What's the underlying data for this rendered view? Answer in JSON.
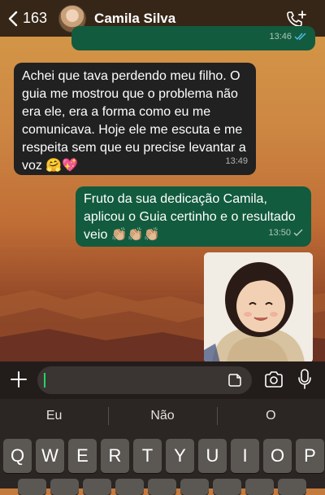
{
  "header": {
    "back_count": "163",
    "contact_name": "Camila Silva"
  },
  "messages": [
    {
      "direction": "out",
      "text": "",
      "time": "13:46",
      "status": "read"
    },
    {
      "direction": "in",
      "text": "Achei que tava  perdendo meu filho. O guia me mostrou que o problema não era ele, era a forma como eu me comunicava. Hoje ele me escuta e me respeita sem que eu precise levantar a voz 🤗💖",
      "time": "13:49"
    },
    {
      "direction": "out",
      "text": "Fruto da sua dedicação Camila, aplicou o Guia certinho e o resultado veio 👏🏼👏🏼👏🏼",
      "time": "13:50",
      "status": "sent"
    }
  ],
  "input": {
    "value": ""
  },
  "keyboard": {
    "suggestions": [
      "Eu",
      "Não",
      "O"
    ],
    "row1": [
      "Q",
      "W",
      "E",
      "R",
      "T",
      "Y",
      "U",
      "I",
      "O",
      "P"
    ]
  },
  "colors": {
    "outgoing_bubble": "#125b3e",
    "incoming_bubble": "#212121",
    "read_ticks": "#53bdeb",
    "cursor": "#25d366"
  }
}
